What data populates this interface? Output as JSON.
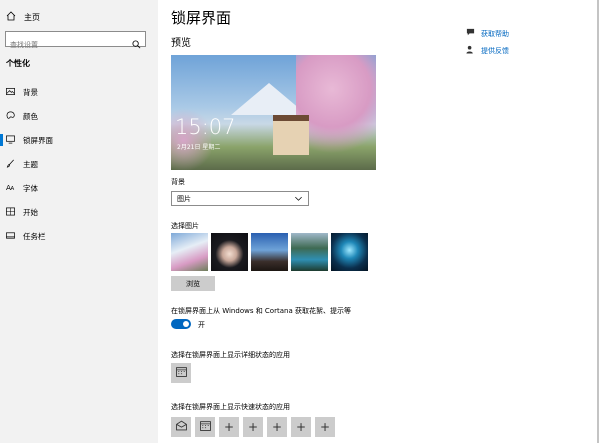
{
  "sidebar": {
    "home_label": "主页",
    "search_placeholder": "查找设置",
    "section_title": "个性化",
    "items": [
      {
        "label": "背景",
        "icon": "image-icon"
      },
      {
        "label": "颜色",
        "icon": "palette-icon"
      },
      {
        "label": "锁屏界面",
        "icon": "monitor-icon",
        "active": true
      },
      {
        "label": "主题",
        "icon": "brush-icon"
      },
      {
        "label": "字体",
        "icon": "font-icon"
      },
      {
        "label": "开始",
        "icon": "start-icon"
      },
      {
        "label": "任务栏",
        "icon": "taskbar-icon"
      }
    ]
  },
  "main": {
    "title": "锁屏界面",
    "preview_label": "预览",
    "preview_time": "15:07",
    "preview_date": "2月21日 星期二",
    "background_label": "背景",
    "background_value": "图片",
    "choose_picture_label": "选择图片",
    "browse_label": "浏览",
    "toggle_label": "在锁屏界面上从 Windows 和 Cortana 获取花絮、提示等",
    "toggle_state": "开",
    "detailed_app_label": "选择在锁屏界面上显示详细状态的应用",
    "quick_apps_label": "选择在锁屏界面上显示快速状态的应用",
    "quick_apps": [
      "mail-icon",
      "calendar-icon",
      "+",
      "+",
      "+",
      "+",
      "+"
    ]
  },
  "right_links": {
    "help": "获取帮助",
    "feedback": "提供反馈"
  },
  "colors": {
    "accent": "#0067c0",
    "sidebar_bg": "#f2f2f2"
  }
}
